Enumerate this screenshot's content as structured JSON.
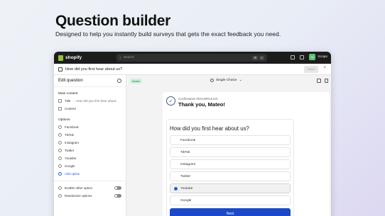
{
  "hero": {
    "title": "Question builder",
    "subtitle": "Designed to help you instantly build surveys that gets the exact feedback you need."
  },
  "topbar": {
    "brand": "shopify",
    "search_placeholder": "Search",
    "kbd1": "⌘",
    "kbd2": "K",
    "store_initial": "Sc",
    "store_name": "Scope"
  },
  "editor_header": {
    "title": "How did you first hear about us?",
    "save_label": "Save",
    "close": "×"
  },
  "sidebar": {
    "heading": "Edit question",
    "main_content_label": "Main content",
    "title_item_prefix": "Title",
    "title_item_value": "– How did you first hear about...",
    "content_item": "Content",
    "options_label": "Options",
    "options": [
      "Facebook",
      "TikTok",
      "Instagram",
      "Twitter",
      "Youtube",
      "Google"
    ],
    "add_option": "Add option",
    "toggles": [
      "Enable other option",
      "Randomize options"
    ]
  },
  "preview": {
    "status_badge": "Active",
    "question_type": "Single Choice",
    "confirmation": "Confirmation #EXAMPLE123",
    "thanks": "Thank you, Mateo!",
    "question": "How did you first hear about us?",
    "options": [
      "Facebook",
      "TikTok",
      "Instagram",
      "Twitter",
      "Youtube",
      "Google"
    ],
    "selected_option": "Youtube",
    "next_label": "Next"
  },
  "colors": {
    "accent": "#1a4ac9",
    "active_badge_bg": "#cdf2d9",
    "topbar_bg": "#1c1c1c"
  }
}
